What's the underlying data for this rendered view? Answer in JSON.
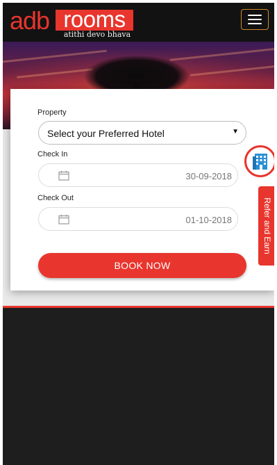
{
  "header": {
    "logo_brand_left": "adb",
    "logo_brand_right": "rooms",
    "logo_tagline": "atithi devo bhava",
    "menu_icon": "hamburger-menu-icon"
  },
  "booking_form": {
    "property_label": "Property",
    "property_select_value": "Select your Preferred Hotel",
    "checkin_label": "Check In",
    "checkin_value": "30-09-2018",
    "checkout_label": "Check Out",
    "checkout_value": "01-10-2018",
    "calendar_icon": "calendar-icon",
    "book_button_label": "BOOK NOW"
  },
  "side_widgets": {
    "hotel_icon": "hotel-building-icon",
    "refer_label": "Refer and Earn"
  },
  "colors": {
    "brand_red": "#e8352d",
    "header_bg": "#121212",
    "menu_border": "#d4882a",
    "page_bg": "#1e1e1e"
  }
}
